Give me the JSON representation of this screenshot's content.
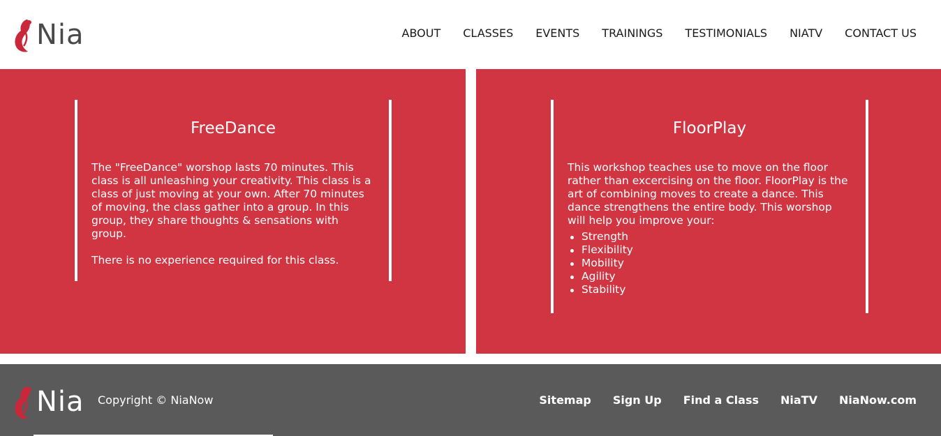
{
  "brand": {
    "name": "Nia",
    "accent_color": "#d13542",
    "footer_bg": "#5a5a5a"
  },
  "nav": {
    "items": [
      "ABOUT",
      "CLASSES",
      "EVENTS",
      "TRAININGS",
      "TESTIMONIALS",
      "NIATV",
      "CONTACT US"
    ]
  },
  "classes": [
    {
      "title": "FreeDance",
      "paragraphs": [
        "The \"FreeDance\" worshop lasts 70 minutes. This class is all unleashing your creativity. This class is a class of just moving at your own. After 70 minutes of moving, the class gather into a group. In this group, they share thoughts & sensations with group.",
        "There is no experience required for this class."
      ]
    },
    {
      "title": "FloorPlay",
      "paragraphs": [
        "This workshop teaches use to move on the floor rather than excercising on the floor. FloorPlay is the art of combining moves to create a dance. This dance strengthens the entire body. This worshop will help you improve your:"
      ],
      "list": [
        "Strength",
        "Flexibility",
        "Mobility",
        "Agility",
        "Stability"
      ]
    }
  ],
  "footer": {
    "copyright": "Copyright © NiaNow",
    "links": [
      "Sitemap",
      "Sign Up",
      "Find a Class",
      "NiaTV",
      "NiaNow.com"
    ]
  }
}
